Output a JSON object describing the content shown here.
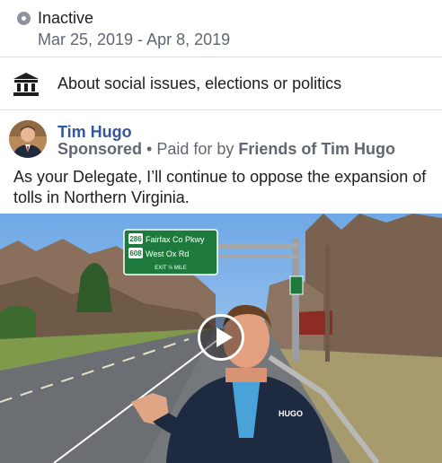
{
  "status": {
    "label": "Inactive",
    "dates": "Mar 25, 2019 - Apr 8, 2019",
    "icon": "status-dot-icon"
  },
  "category": {
    "icon": "government-building-icon",
    "text": "About social issues, elections or politics"
  },
  "ad": {
    "advertiser": "Tim Hugo",
    "sponsored": "Sponsored",
    "separator": " • ",
    "paid_for_prefix": "Paid for by ",
    "paid_for_by": "Friends of Tim Hugo",
    "body": "As your Delegate, I’ll continue to oppose the expansion of tolls in Northern Virginia."
  },
  "video": {
    "sign_route_1": "286",
    "sign_line_1": "Fairfax Co Pkwy",
    "sign_route_2": "608",
    "sign_line_2": "West Ox Rd",
    "sign_exit": "EXIT ½ MILE",
    "jacket_logo": "HUGO",
    "play_icon": "play-icon"
  },
  "colors": {
    "name_link": "#365899",
    "secondary_text": "#606770",
    "divider": "#dddfe2",
    "sign_green": "#1e7a3c"
  }
}
